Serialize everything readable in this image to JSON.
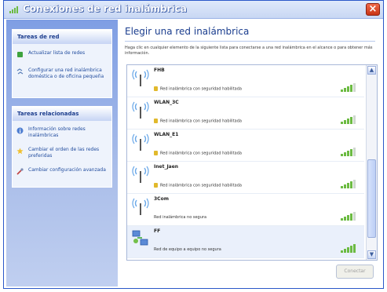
{
  "window": {
    "title": "Conexiones de red inalámbrica",
    "close_label": "×"
  },
  "sidebar": {
    "panels": [
      {
        "header": "Tareas de red",
        "items": [
          {
            "label": "Actualizar lista de redes",
            "icon": "refresh-icon"
          },
          {
            "label": "Configurar una red inalámbrica doméstica o de oficina pequeña",
            "icon": "setup-network-icon"
          }
        ]
      },
      {
        "header": "Tareas relacionadas",
        "items": [
          {
            "label": "Información sobre redes inalámbricas",
            "icon": "info-icon"
          },
          {
            "label": "Cambiar el orden de las redes preferidas",
            "icon": "star-icon"
          },
          {
            "label": "Cambiar configuración avanzada",
            "icon": "settings-icon"
          }
        ]
      }
    ]
  },
  "main": {
    "heading": "Elegir una red inalámbrica",
    "description": "Haga clic en cualquier elemento de la siguiente lista para conectarse a una red inalámbrica en el alcance o para obtener más información.",
    "networks": [
      {
        "name": "FHB",
        "status": "Red inalámbrica con seguridad habilitada",
        "secured": true,
        "signal_bars": 4,
        "icon": "wifi-antenna-icon"
      },
      {
        "name": "WLAN_3C",
        "status": "Red inalámbrica con seguridad habilitada",
        "secured": true,
        "signal_bars": 4,
        "icon": "wifi-antenna-icon"
      },
      {
        "name": "WLAN_E1",
        "status": "Red inalámbrica con seguridad habilitada",
        "secured": true,
        "signal_bars": 4,
        "icon": "wifi-antenna-icon"
      },
      {
        "name": "Inet_Jaen",
        "status": "Red inalámbrica con seguridad habilitada",
        "secured": true,
        "signal_bars": 4,
        "icon": "wifi-antenna-icon"
      },
      {
        "name": "3Com",
        "status": "Red inalámbrica no segura",
        "secured": false,
        "signal_bars": 4,
        "icon": "wifi-antenna-icon"
      },
      {
        "name": "FF",
        "status": "Red de equipo a equipo no segura",
        "secured": false,
        "signal_bars": 5,
        "icon": "computer-to-computer-icon"
      }
    ],
    "connect_label": "Conectar"
  },
  "colors": {
    "title_blue": "#2b58c8",
    "sidebar_blue": "#7f9ee4",
    "heading_blue": "#1a3d8e",
    "signal_green": "#6cbb42",
    "lock_yellow": "#e1b92c"
  }
}
